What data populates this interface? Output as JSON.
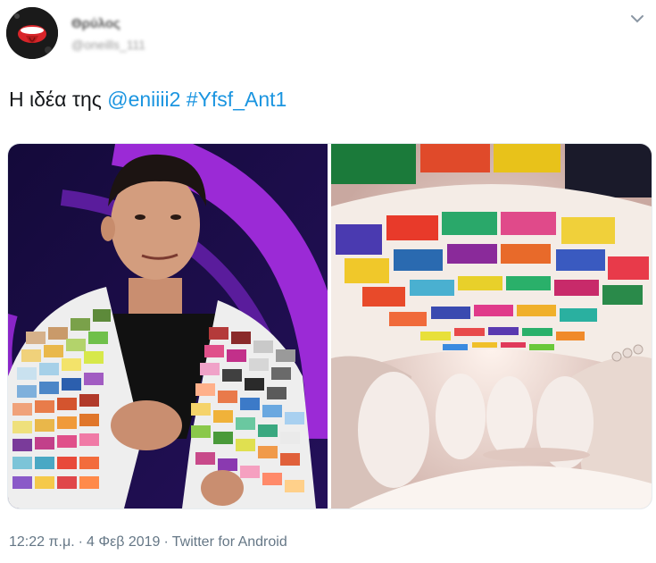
{
  "user": {
    "display_name": "Θρύλος",
    "handle": "@oneills_111"
  },
  "tweet": {
    "lead": "Η ιδέα της ",
    "mention": "@eniiii2",
    "hashtag": "#Yfsf_Ant1"
  },
  "meta": {
    "time": "12:22 π.μ.",
    "separator": "·",
    "date": "4 Φεβ 2019",
    "source": "Twitter for Android"
  },
  "icons": {
    "avatar": "rolling-stones-tongue-logo",
    "menu": "chevron-down-icon"
  }
}
